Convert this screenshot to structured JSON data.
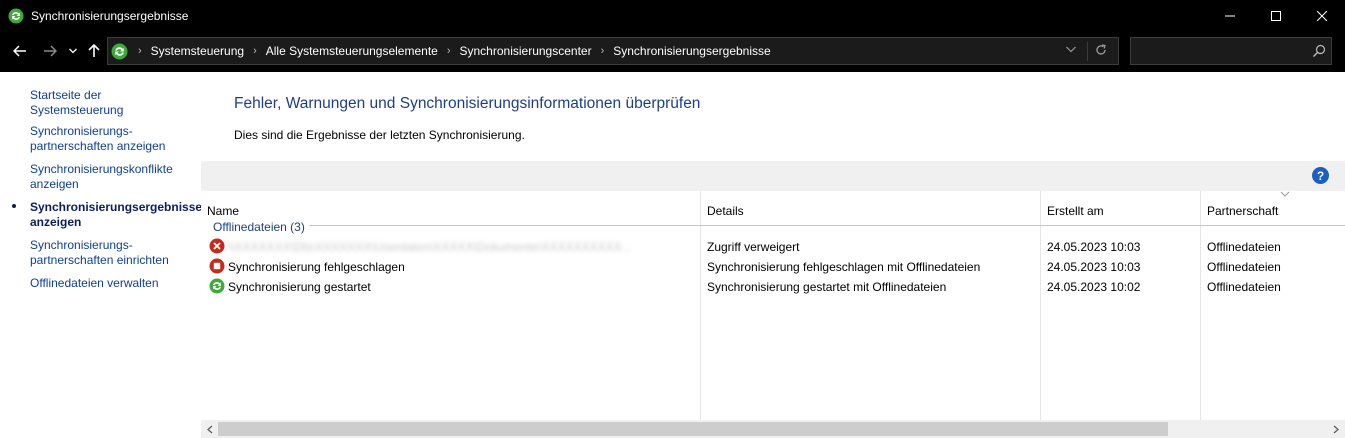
{
  "window": {
    "title": "Synchronisierungsergebnisse",
    "controls": {
      "minimize": "minimize",
      "maximize": "maximize",
      "close": "close"
    }
  },
  "address_bar": {
    "breadcrumbs": [
      "Systemsteuerung",
      "Alle Systemsteuerungselemente",
      "Synchronisierungscenter",
      "Synchronisierungsergebnisse"
    ]
  },
  "search": {
    "placeholder": "",
    "value": ""
  },
  "left_nav": {
    "items": [
      {
        "label": "Startseite der Systemsteuerung",
        "active": false
      },
      {
        "label": "Synchronisierungs-partnerschaften anzeigen",
        "active": false
      },
      {
        "label": "Synchronisierungskonflikte anzeigen",
        "active": false
      },
      {
        "label": "Synchronisierungsergebnisse anzeigen",
        "active": true
      },
      {
        "label": "Synchronisierungs-partnerschaften einrichten",
        "active": false
      },
      {
        "label": "Offlinedateien verwalten",
        "active": false
      }
    ]
  },
  "main": {
    "title": "Fehler, Warnungen und Synchronisierungsinformationen überprüfen",
    "description": "Dies sind die Ergebnisse der letzten Synchronisierung."
  },
  "list": {
    "columns": [
      "Name",
      "Details",
      "Erstellt am",
      "Partnerschaft"
    ],
    "group_label": "Offlinedateien (3)",
    "rows": [
      {
        "icon": "error-icon",
        "name": "\\\\XXXXXXX\\Dfs\\XXXXXXX\\Userdaten\\XXXXX\\Dokumente\\XXXXXXXXXX...",
        "name_redacted": true,
        "details": "Zugriff verweigert",
        "created": "24.05.2023 10:03",
        "partnership": "Offlinedateien"
      },
      {
        "icon": "stop-icon",
        "name": "Synchronisierung fehlgeschlagen",
        "name_redacted": false,
        "details": "Synchronisierung fehlgeschlagen mit Offlinedateien",
        "created": "24.05.2023 10:03",
        "partnership": "Offlinedateien"
      },
      {
        "icon": "sync-icon",
        "name": "Synchronisierung gestartet",
        "name_redacted": false,
        "details": "Synchronisierung gestartet mit Offlinedateien",
        "created": "24.05.2023 10:02",
        "partnership": "Offlinedateien"
      }
    ]
  },
  "colors": {
    "link": "#0f3e9b",
    "heading": "#1e3e8a",
    "error": "#c42b1c",
    "sync_green": "#3fa93a"
  },
  "help": {
    "label": "?"
  }
}
